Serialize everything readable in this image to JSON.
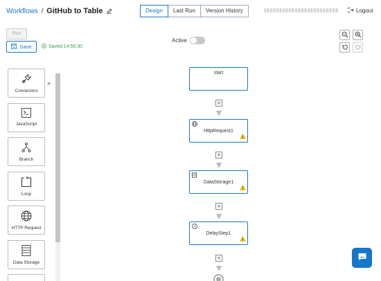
{
  "header": {
    "breadcrumb_link": "Workflows",
    "breadcrumb_sep": "/",
    "workflow_title": "GitHub to Table",
    "tabs": [
      {
        "label": "Design"
      },
      {
        "label": "Last Run"
      },
      {
        "label": "Version History"
      }
    ],
    "logout_label": "Logout"
  },
  "toolbar": {
    "run_label": "Run",
    "save_label": "Save",
    "saved_status": "Saved 14:56:30",
    "active_label": "Active",
    "active_on": false
  },
  "sidebar": {
    "items": [
      {
        "label": "Connectors",
        "icon": "plug-icon"
      },
      {
        "label": "JavaScript",
        "icon": "terminal-icon"
      },
      {
        "label": "Branch",
        "icon": "branch-icon"
      },
      {
        "label": "Loop",
        "icon": "loop-icon"
      },
      {
        "label": "HTTP Request",
        "icon": "globe-icon"
      },
      {
        "label": "Data Storage",
        "icon": "storage-icon"
      }
    ],
    "expand_icon": "double-chevron-right-icon"
  },
  "canvas": {
    "nodes": [
      {
        "label": "start",
        "icon": ""
      },
      {
        "label": "HttpRequest1",
        "icon": "globe-icon",
        "warning": true
      },
      {
        "label": "DataStorage1",
        "icon": "storage-icon",
        "warning": true
      },
      {
        "label": "DelayStep1",
        "icon": "clock-icon",
        "warning": true
      }
    ],
    "add_step_symbol": "+"
  },
  "colors": {
    "accent": "#1677c9",
    "saved_green": "#3c9a4a",
    "warning": "#f0b400"
  }
}
